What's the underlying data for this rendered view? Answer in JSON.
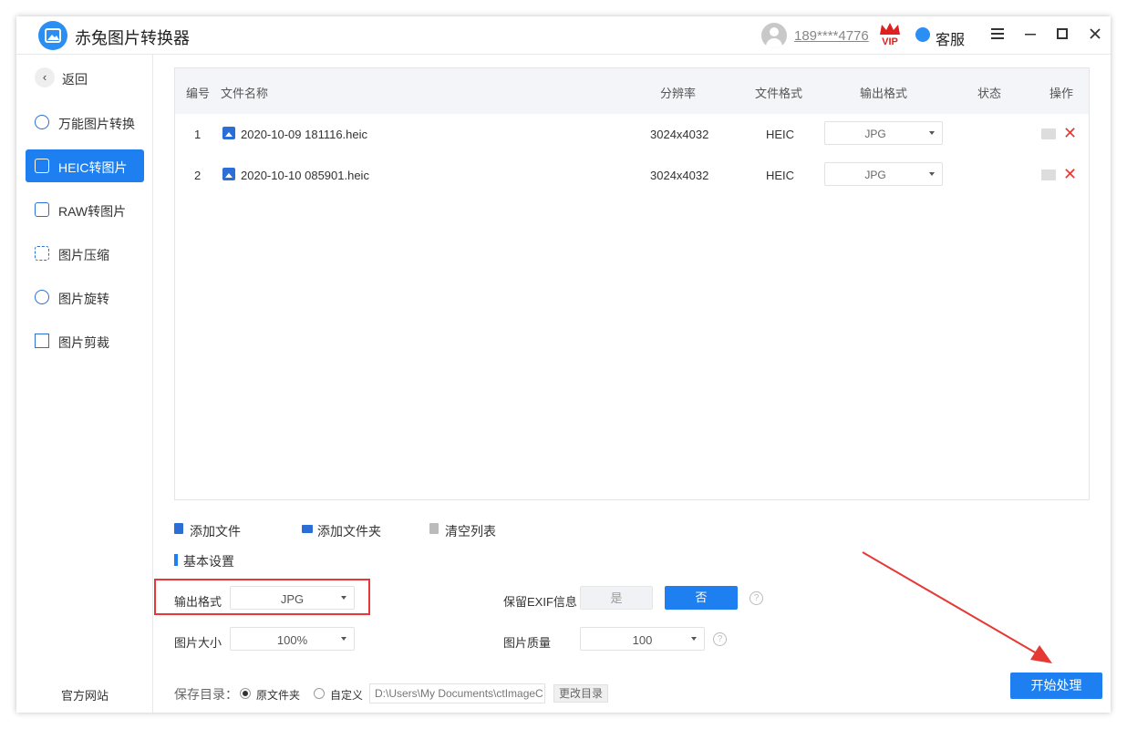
{
  "titlebar": {
    "app_title": "赤兔图片转换器",
    "user_phone": "189****4776",
    "vip_badge": "VIP",
    "service_label": "客服",
    "menu_icon": "menu-icon",
    "minimize_icon": "minimize-icon",
    "maximize_icon": "maximize-icon",
    "close_icon": "close-icon"
  },
  "sidebar": {
    "back_label": "返回",
    "items": [
      {
        "label": "万能图片转换",
        "icon": "image-convert-icon"
      },
      {
        "label": "HEIC转图片",
        "icon": "heic-icon"
      },
      {
        "label": "RAW转图片",
        "icon": "raw-icon"
      },
      {
        "label": "图片压缩",
        "icon": "compress-icon"
      },
      {
        "label": "图片旋转",
        "icon": "rotate-icon"
      },
      {
        "label": "图片剪裁",
        "icon": "crop-icon"
      }
    ],
    "active_index": 1,
    "official_site": "官方网站"
  },
  "table": {
    "headers": {
      "index": "编号",
      "filename": "文件名称",
      "resolution": "分辨率",
      "format": "文件格式",
      "output": "输出格式",
      "status": "状态",
      "action": "操作"
    },
    "rows": [
      {
        "index": "1",
        "filename": "2020-10-09 181116.heic",
        "resolution": "3024x4032",
        "format": "HEIC",
        "output": "JPG",
        "status": ""
      },
      {
        "index": "2",
        "filename": "2020-10-10 085901.heic",
        "resolution": "3024x4032",
        "format": "HEIC",
        "output": "JPG",
        "status": ""
      }
    ]
  },
  "toolbar": {
    "add_file": "添加文件",
    "add_folder": "添加文件夹",
    "clear_list": "清空列表"
  },
  "settings": {
    "title": "基本设置",
    "output_format_label": "输出格式",
    "output_format_value": "JPG",
    "keep_exif_label": "保留EXIF信息",
    "exif_yes": "是",
    "exif_no": "否",
    "image_size_label": "图片大小",
    "image_size_value": "100%",
    "quality_label": "图片质量",
    "quality_value": "100",
    "help_glyph": "?"
  },
  "save": {
    "label": "保存目录：",
    "option_original": "原文件夹",
    "option_custom": "自定义",
    "path": "D:\\Users\\My Documents\\ctImageC",
    "change_button": "更改目录"
  },
  "start_button": "开始处理",
  "colors": {
    "accent": "#1e80f0",
    "annotation_red": "#e53935"
  }
}
